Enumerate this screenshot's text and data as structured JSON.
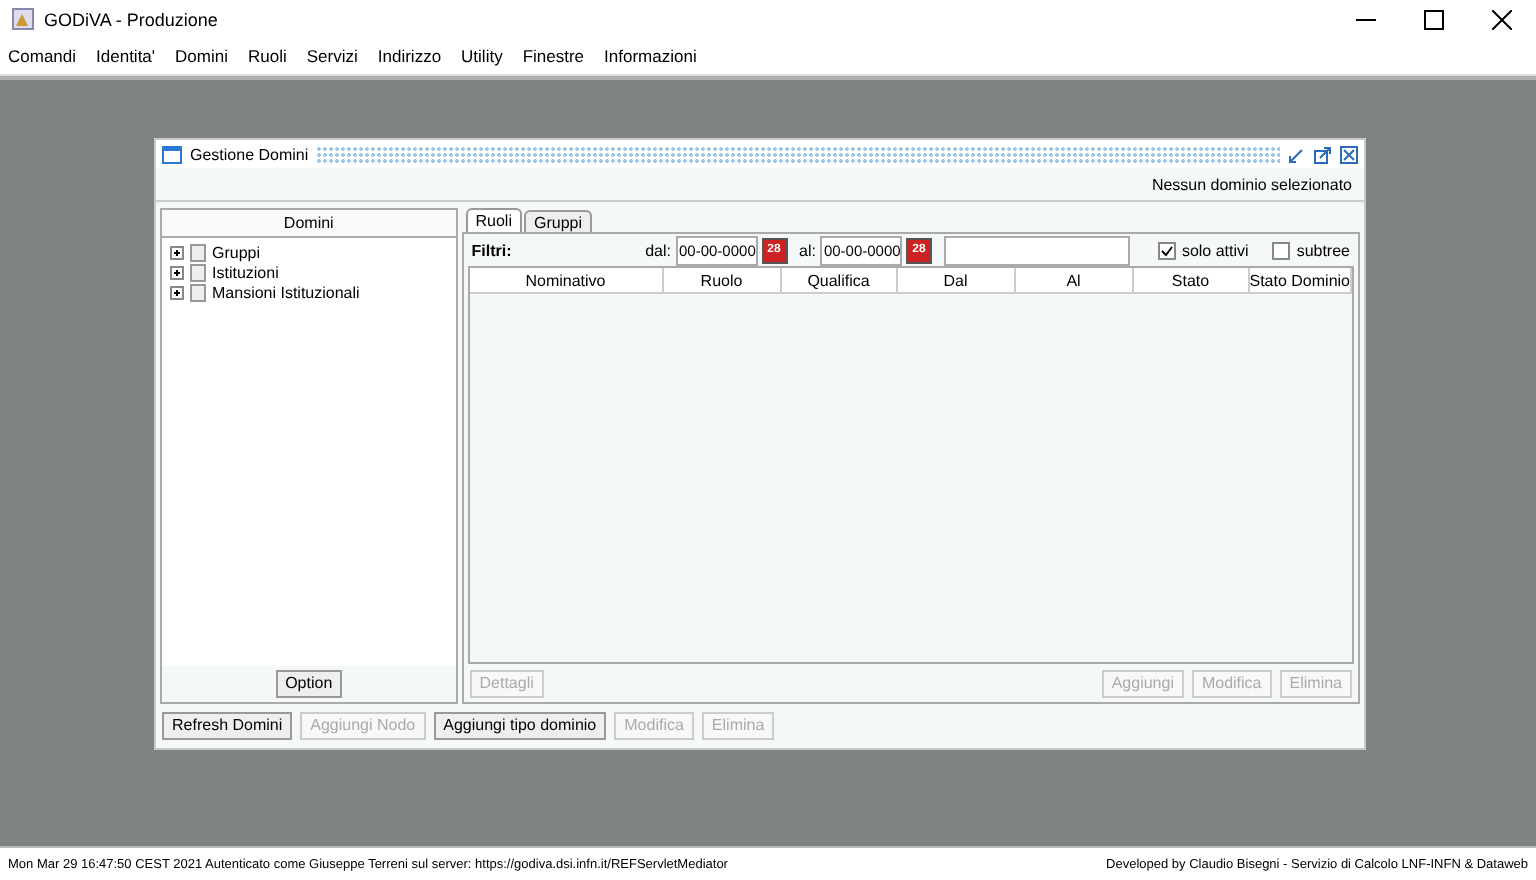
{
  "window": {
    "title": "GODiVA - Produzione"
  },
  "menu": [
    "Comandi",
    "Identita'",
    "Domini",
    "Ruoli",
    "Servizi",
    "Indirizzo",
    "Utility",
    "Finestre",
    "Informazioni"
  ],
  "frame": {
    "title": "Gestione Domini",
    "status": "Nessun dominio selezionato"
  },
  "tree": {
    "header": "Domini",
    "items": [
      {
        "label": "Gruppi",
        "expanded": false
      },
      {
        "label": "Istituzioni",
        "expanded": false
      },
      {
        "label": "Mansioni Istituzionali",
        "expanded": false
      }
    ],
    "option_button": "Option"
  },
  "tabs": [
    {
      "label": "Ruoli",
      "selected": true
    },
    {
      "label": "Gruppi",
      "selected": false
    }
  ],
  "filters": {
    "label": "Filtri:",
    "from_label": "dal:",
    "from_value": "00-00-0000",
    "to_label": "al:",
    "to_value": "00-00-0000",
    "from_calendar_text": "28",
    "to_calendar_text": "28",
    "checks": [
      {
        "label": "solo attivi",
        "checked": true
      },
      {
        "label": "subtree",
        "checked": false
      }
    ]
  },
  "table": {
    "columns": [
      "Nominativo",
      "Ruolo",
      "Qualifica",
      "Dal",
      "Al",
      "Stato",
      "Stato Dominio"
    ]
  },
  "panel_buttons": [
    {
      "label": "Dettagli",
      "disabled": true
    },
    {
      "label": "Aggiungi",
      "disabled": true
    },
    {
      "label": "Modifica",
      "disabled": true
    },
    {
      "label": "Elimina",
      "disabled": true
    }
  ],
  "bottom_buttons": [
    {
      "label": "Refresh Domini",
      "disabled": false
    },
    {
      "label": "Aggiungi Nodo",
      "disabled": true
    },
    {
      "label": "Aggiungi tipo dominio",
      "disabled": false
    },
    {
      "label": "Modifica",
      "disabled": true
    },
    {
      "label": "Elimina",
      "disabled": true
    }
  ],
  "status_bar": {
    "left": "Mon Mar 29 16:47:50 CEST 2021 Autenticato come Giuseppe Terreni sul server: https://godiva.dsi.infn.it/REFServletMediator",
    "right": "Developed by Claudio Bisegni - Servizio di Calcolo LNF-INFN & Dataweb"
  }
}
